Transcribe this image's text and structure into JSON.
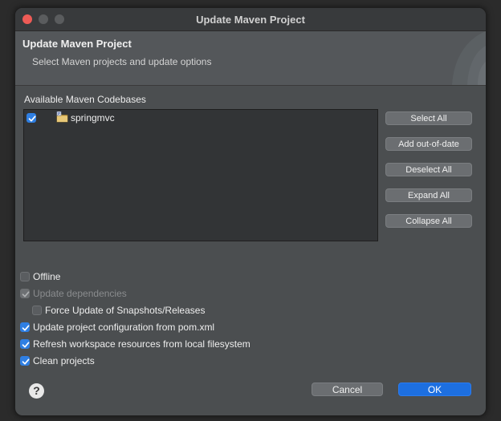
{
  "window": {
    "title": "Update Maven Project"
  },
  "banner": {
    "title": "Update Maven Project",
    "subtitle": "Select Maven projects and update options"
  },
  "codebases": {
    "label": "Available Maven Codebases",
    "items": [
      {
        "name": "springmvc",
        "checked": true
      }
    ]
  },
  "buttons": {
    "select_all": "Select All",
    "add_out_of_date": "Add out-of-date",
    "deselect_all": "Deselect All",
    "expand_all": "Expand All",
    "collapse_all": "Collapse All"
  },
  "options": {
    "offline": {
      "label": "Offline",
      "checked": false
    },
    "update_dependencies": {
      "label": "Update dependencies",
      "checked": true,
      "enabled": false
    },
    "force_update": {
      "label": "Force Update of Snapshots/Releases",
      "checked": false
    },
    "update_config": {
      "label": "Update project configuration from pom.xml",
      "checked": true
    },
    "refresh_workspace": {
      "label": "Refresh workspace resources from local filesystem",
      "checked": true
    },
    "clean_projects": {
      "label": "Clean projects",
      "checked": true
    }
  },
  "footer": {
    "help": "?",
    "cancel": "Cancel",
    "ok": "OK"
  },
  "colors": {
    "accent": "#1d6fe0",
    "close": "#ee5b56",
    "window_bg": "#4b4e50"
  }
}
